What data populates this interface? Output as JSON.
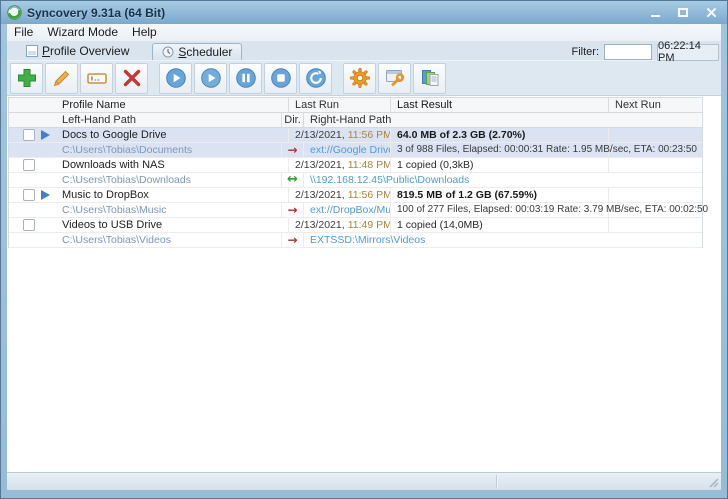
{
  "window": {
    "title": "Syncovery 9.31a (64 Bit)"
  },
  "menu": {
    "items": [
      {
        "label": "File"
      },
      {
        "label": "Wizard Mode"
      },
      {
        "label": "Help"
      }
    ]
  },
  "tabs": {
    "overview": {
      "mnemonic": "P",
      "rest": "rofile Overview",
      "icon": "profile-list-icon"
    },
    "scheduler": {
      "mnemonic": "S",
      "rest": "cheduler",
      "icon": "clock-icon"
    }
  },
  "filter": {
    "label": "Filter:",
    "value": "",
    "clock": "06:22:14 PM"
  },
  "toolbar": {
    "buttons": [
      {
        "id": "add-profile",
        "icon": "green-plus"
      },
      {
        "id": "edit-profile",
        "icon": "pencil"
      },
      {
        "id": "rename-profile",
        "icon": "text-field"
      },
      {
        "id": "delete-profile",
        "icon": "red-x"
      },
      {
        "id": "run",
        "icon": "play-circle"
      },
      {
        "id": "run-attended",
        "icon": "play-circle"
      },
      {
        "id": "pause",
        "icon": "pause-circle"
      },
      {
        "id": "stop",
        "icon": "stop-circle"
      },
      {
        "id": "restart",
        "icon": "refresh-circle"
      },
      {
        "id": "settings",
        "icon": "orange-gear"
      },
      {
        "id": "program-settings",
        "icon": "window-wrench"
      },
      {
        "id": "copy-profiles",
        "icon": "documents"
      }
    ]
  },
  "table": {
    "headers": {
      "profile_name": "Profile Name",
      "last_run": "Last Run",
      "last_result": "Last Result",
      "next_run": "Next Run",
      "left_path": "Left-Hand Path",
      "dir": "Dir.",
      "right_path": "Right-Hand Path"
    },
    "rows": [
      {
        "name": "Docs to Google Drive",
        "last_run_date": "2/13/2021,",
        "last_run_time": "11:56 PM",
        "result": "64.0 MB of 2.3 GB (2.70%)",
        "next_run": "",
        "left_path": "C:\\Users\\Tobias\\Documents",
        "dir": "→",
        "right_path": "ext://Google Drive/Do...",
        "detail": "3 of 988 Files, Elapsed: 00:00:31  Rate: 1.95 MB/sec, ETA: 00:23:50"
      },
      {
        "name": "Downloads with NAS",
        "last_run_date": "2/13/2021,",
        "last_run_time": "11:48 PM",
        "result": "1 copied (0,3kB)",
        "next_run": "",
        "left_path": "C:\\Users\\Tobias\\Downloads",
        "dir": "↔",
        "right_path": "\\\\192.168.12.45\\Public\\Downloads",
        "detail": ""
      },
      {
        "name": "Music to DropBox",
        "last_run_date": "2/13/2021,",
        "last_run_time": "11:56 PM",
        "result": "819.5 MB of 1.2 GB (67.59%)",
        "next_run": "",
        "left_path": "C:\\Users\\Tobias\\Music",
        "dir": "→",
        "right_path": "ext://DropBox/Music",
        "detail": "100 of 277 Files, Elapsed: 00:03:19  Rate: 3.79 MB/sec, ETA: 00:02:50"
      },
      {
        "name": "Videos to USB Drive",
        "last_run_date": "2/13/2021,",
        "last_run_time": "11:49 PM",
        "result": "1 copied (14,0MB)",
        "next_run": "",
        "left_path": "C:\\Users\\Tobias\\Videos",
        "dir": "→",
        "right_path": "EXTSSD:\\Mirrors\\Videos",
        "detail": ""
      }
    ]
  }
}
